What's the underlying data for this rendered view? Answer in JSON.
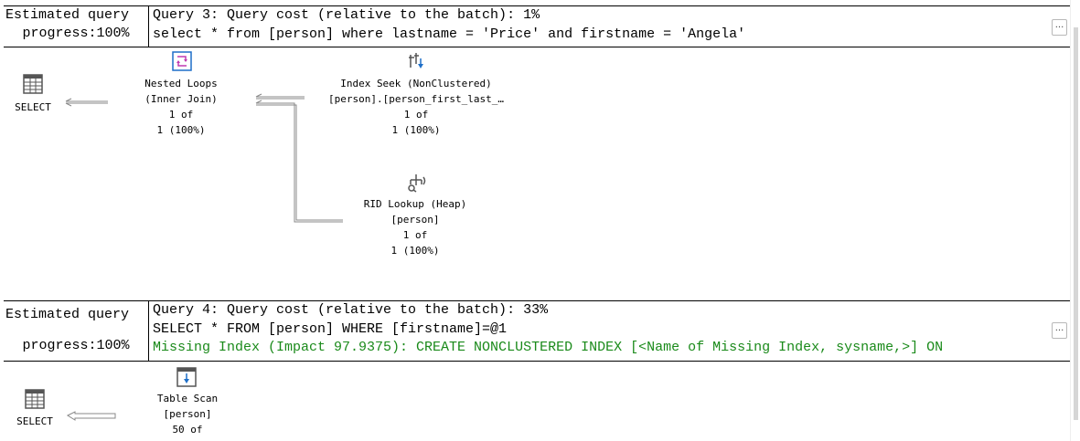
{
  "queries": [
    {
      "progress_label_1": "Estimated query",
      "progress_label_2": "progress:100%",
      "title": "Query 3: Query cost (relative to the batch): 1%",
      "sql": "select * from [person] where lastname = 'Price' and firstname = 'Angela'",
      "collapse_label": "...",
      "nodes": {
        "select": {
          "icon": "select-result-icon",
          "label": "SELECT"
        },
        "nested_loops": {
          "icon": "nested-loops-icon",
          "line1": "Nested Loops",
          "line2": "(Inner Join)",
          "line3": "1 of",
          "line4": "1 (100%)"
        },
        "index_seek": {
          "icon": "index-seek-icon",
          "line1": "Index Seek (NonClustered)",
          "line2": "[person].[person_first_last_…",
          "line3": "1 of",
          "line4": "1 (100%)"
        },
        "rid_lookup": {
          "icon": "rid-lookup-icon",
          "line1": "RID Lookup (Heap)",
          "line2": "[person]",
          "line3": "1 of",
          "line4": "1 (100%)"
        }
      }
    },
    {
      "progress_label_1": "Estimated query",
      "progress_label_2": "progress:100%",
      "title": "Query 4: Query cost (relative to the batch): 33%",
      "sql": "SELECT * FROM [person] WHERE [firstname]=@1",
      "missing_index": "Missing Index (Impact 97.9375): CREATE NONCLUSTERED INDEX [<Name of Missing Index, sysname,>] ON",
      "collapse_label": "...",
      "nodes": {
        "select": {
          "icon": "select-result-icon",
          "label": "SELECT"
        },
        "table_scan": {
          "icon": "table-scan-icon",
          "line1": "Table Scan",
          "line2": "[person]",
          "line3": "50 of"
        }
      }
    }
  ],
  "colors": {
    "missing_index": "#1a8a1a",
    "accent": "#1e6fc8",
    "icon_gray": "#555555"
  }
}
